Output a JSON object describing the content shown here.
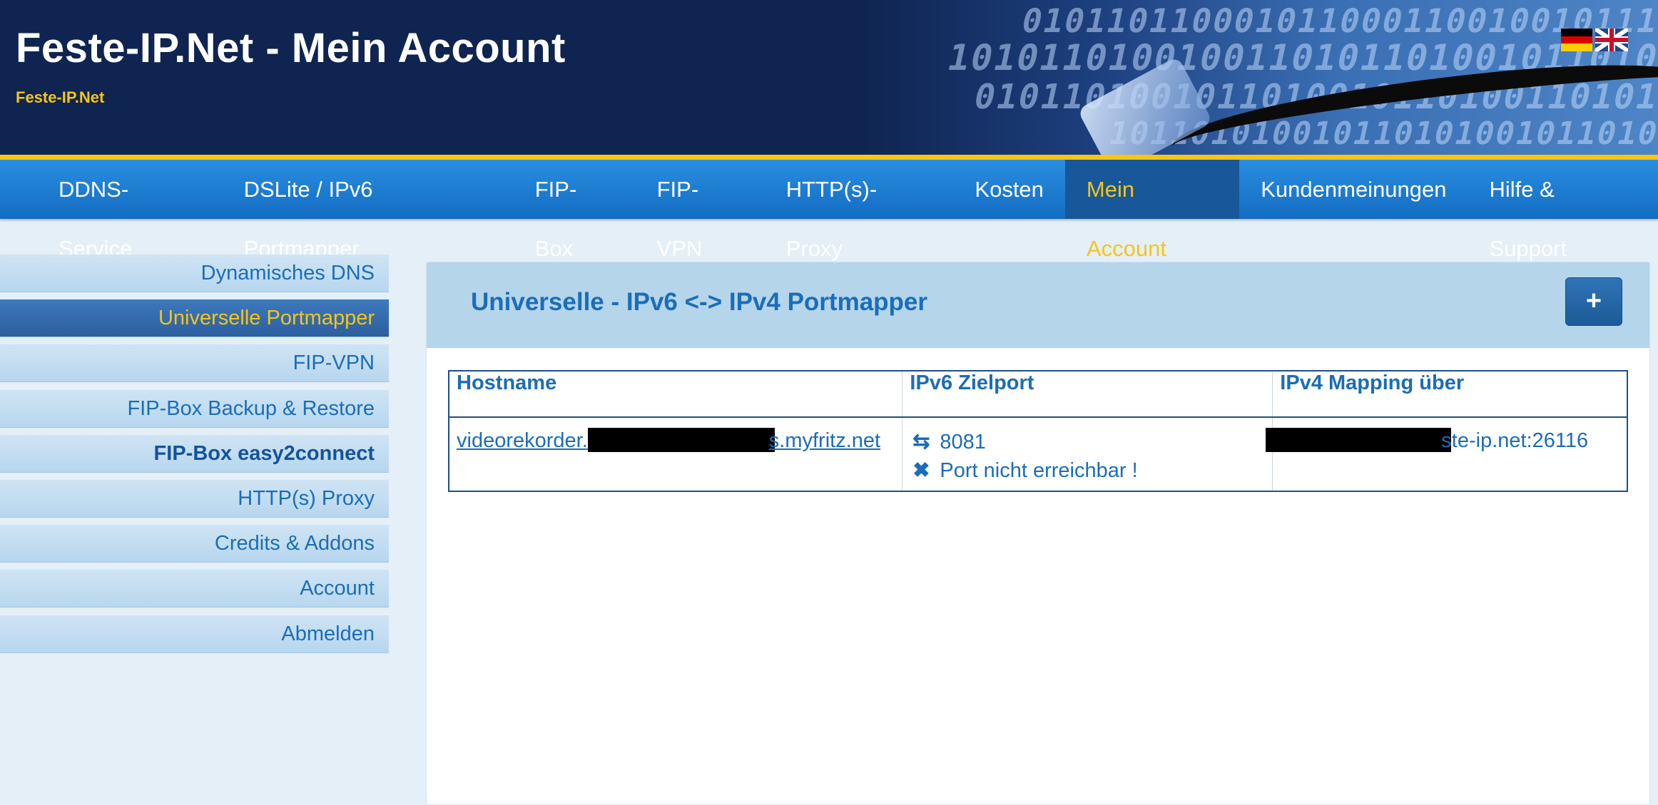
{
  "header": {
    "title": "Feste-IP.Net - Mein Account",
    "subtitle": "Feste-IP.Net",
    "binary_rows": [
      "010110110001011000110010010111",
      "1010110100100110101101001011010",
      "0101101001011010010110100110101",
      "101101010010110101001011010"
    ],
    "flags": [
      {
        "name": "german-flag-icon",
        "colors": [
          "#000000",
          "#dd0000",
          "#ffce00"
        ]
      },
      {
        "name": "uk-flag-icon"
      }
    ]
  },
  "nav": {
    "items": [
      {
        "label": "DDNS-Service"
      },
      {
        "label": "DSLite / IPv6 Portmapper"
      },
      {
        "label": "FIP-Box"
      },
      {
        "label": "FIP-VPN"
      },
      {
        "label": "HTTP(s)-Proxy"
      },
      {
        "label": "Kosten"
      },
      {
        "label": "Mein Account",
        "active": true
      },
      {
        "label": "Kundenmeinungen"
      },
      {
        "label": "Hilfe & Support"
      }
    ]
  },
  "sidebar": {
    "items": [
      {
        "label": "Dynamisches DNS"
      },
      {
        "label": "Universelle Portmapper",
        "active": true
      },
      {
        "label": "FIP-VPN"
      },
      {
        "label": "FIP-Box Backup & Restore"
      },
      {
        "label": "FIP-Box easy2connect",
        "bold": true
      },
      {
        "label": "HTTP(s) Proxy"
      },
      {
        "label": "Credits & Addons"
      },
      {
        "label": "Account"
      },
      {
        "label": "Abmelden"
      }
    ]
  },
  "panel": {
    "title": "Universelle - IPv6 <-> IPv4 Portmapper",
    "add_button_label": "+",
    "table": {
      "headers": [
        "Hostname",
        "IPv6 Zielport",
        "IPv4 Mapping über"
      ],
      "rows": [
        {
          "hostname_prefix": "videorekorder.",
          "hostname_suffix": "s.myfritz.net",
          "port": "8081",
          "port_icon": "exchange-arrows-icon",
          "status": "Port nicht erreichbar !",
          "status_icon": "x-mark-icon",
          "ipv4_suffix": "ste-ip.net:26116"
        }
      ]
    }
  },
  "colors": {
    "header_bg": "#0f2450",
    "nav_bg": "#1a7bd3",
    "accent_yellow": "#f5c518",
    "link_blue": "#1b6db7",
    "panel_head_bg": "#b5d5eb"
  }
}
